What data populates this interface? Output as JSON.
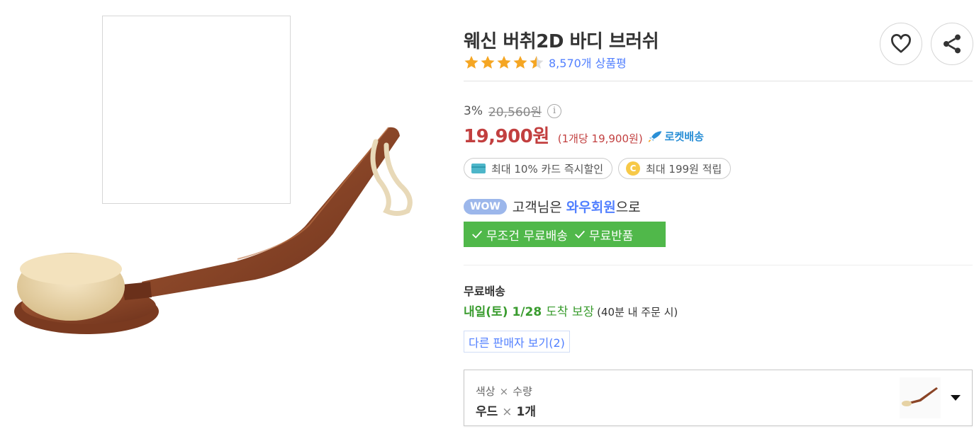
{
  "product": {
    "title": "웨신 버취2D 바디 브러쉬",
    "rating": 4.5,
    "review_count": "8,570개 상품평"
  },
  "price": {
    "discount_rate": "3%",
    "original_price": "20,560원",
    "info_icon": "i",
    "sale_price": "19,900원",
    "unit_price": "(1개당 19,900원)",
    "delivery_badge": "로켓배송"
  },
  "benefits": {
    "card_discount": "최대 10% 카드 즉시할인",
    "cashback_icon_letter": "C",
    "cashback": "최대 199원 적립"
  },
  "wow": {
    "badge": "WOW",
    "prefix": "고객님은",
    "member": "와우회원",
    "suffix": "으로",
    "free_shipping": "무조건 무료배송",
    "free_return": "무료반품"
  },
  "shipping": {
    "title": "무료배송",
    "arrival_day": "내일(토)",
    "arrival_date": "1/28",
    "guarantee": "도착 보장",
    "condition": "(40분 내 주문 시)"
  },
  "other_sellers": "다른 판매자 보기(2)",
  "option": {
    "label_color": "색상",
    "label_qty": "수량",
    "sep": "×",
    "value_color": "우드",
    "value_qty": "1개"
  },
  "icons": {
    "wishlist": "heart-icon",
    "share": "share-icon",
    "rocket": "rocket-icon",
    "card": "card-icon",
    "coin": "coin-icon",
    "check": "check-icon",
    "dropdown": "chevron-down-icon"
  },
  "colors": {
    "price_red": "#ae0000",
    "link_blue": "#346aff",
    "star_orange": "#f5a623",
    "green": "#50b84a",
    "wow_badge": "#9cb7eb"
  }
}
